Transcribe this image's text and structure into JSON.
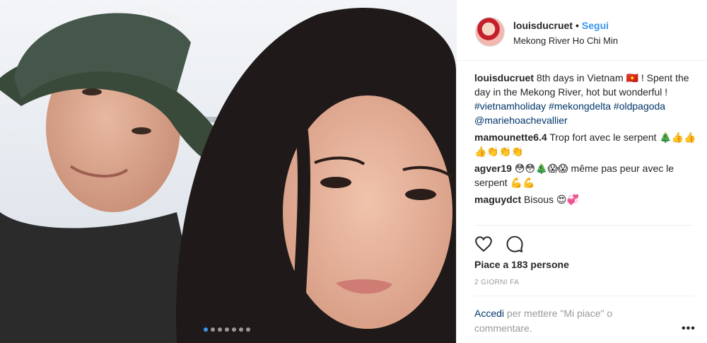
{
  "post": {
    "username": "louisducruet",
    "separator": "•",
    "follow_label": "Segui",
    "location": "Mekong River Ho Chi Min",
    "hat_text": "VIETNAM",
    "carousel_dots": 7,
    "caption": {
      "author": "louisducruet",
      "text_1": "8th days in Vietnam 🇻🇳 ! Spent the day in the Mekong River, hot but wonderful ! ",
      "tag_1": "#vietnamholiday",
      "tag_2": "#mekongdelta",
      "tag_3": "#oldpagoda",
      "tag_4": "@mariehoachevallier"
    },
    "comments": [
      {
        "author": "mamounette6.4",
        "text": "Trop fort avec le serpent 🎄👍👍👍👏👏👏"
      },
      {
        "author": "agver19",
        "text": "😳😳🎄😱😱 même pas peur avec le serpent 💪💪"
      },
      {
        "author": "maguydct",
        "text": "Bisous 😍💞"
      }
    ],
    "likes_text": "Piace a 183 persone",
    "time_ago": "2 GIORNI FA",
    "login_link": "Accedi",
    "login_text": " per mettere \"Mi piace\" o commentare.",
    "more_label": "•••"
  }
}
